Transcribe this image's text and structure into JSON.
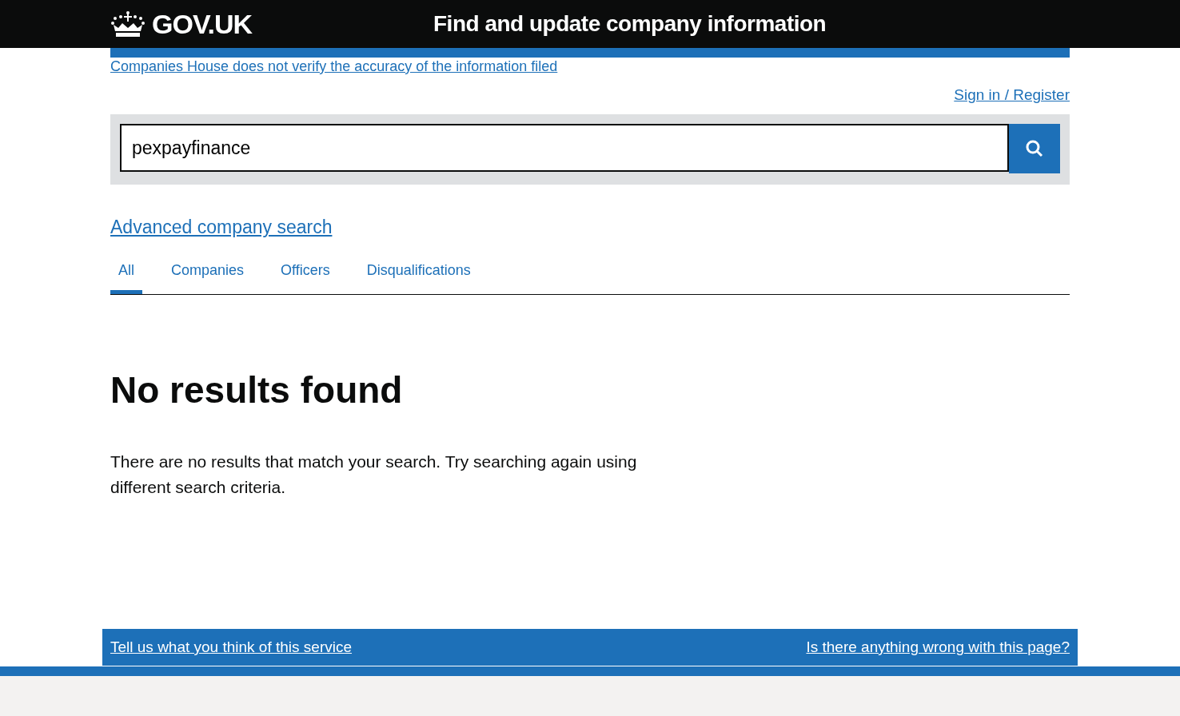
{
  "header": {
    "logo": "GOV.UK",
    "service_name": "Find and update company information"
  },
  "notice_link": "Companies House does not verify the accuracy of the information filed",
  "sign_in_link": "Sign in / Register",
  "search": {
    "value": "pexpayfinance"
  },
  "advanced_search_link": "Advanced company search",
  "tabs": [
    {
      "label": "All",
      "selected": true
    },
    {
      "label": "Companies",
      "selected": false
    },
    {
      "label": "Officers",
      "selected": false
    },
    {
      "label": "Disqualifications",
      "selected": false
    }
  ],
  "heading": "No results found",
  "message": "There are no results that match your search. Try searching again using different search criteria.",
  "feedback": {
    "left_link": "Tell us what you think of this service",
    "right_link": "Is there anything wrong with this page?"
  }
}
